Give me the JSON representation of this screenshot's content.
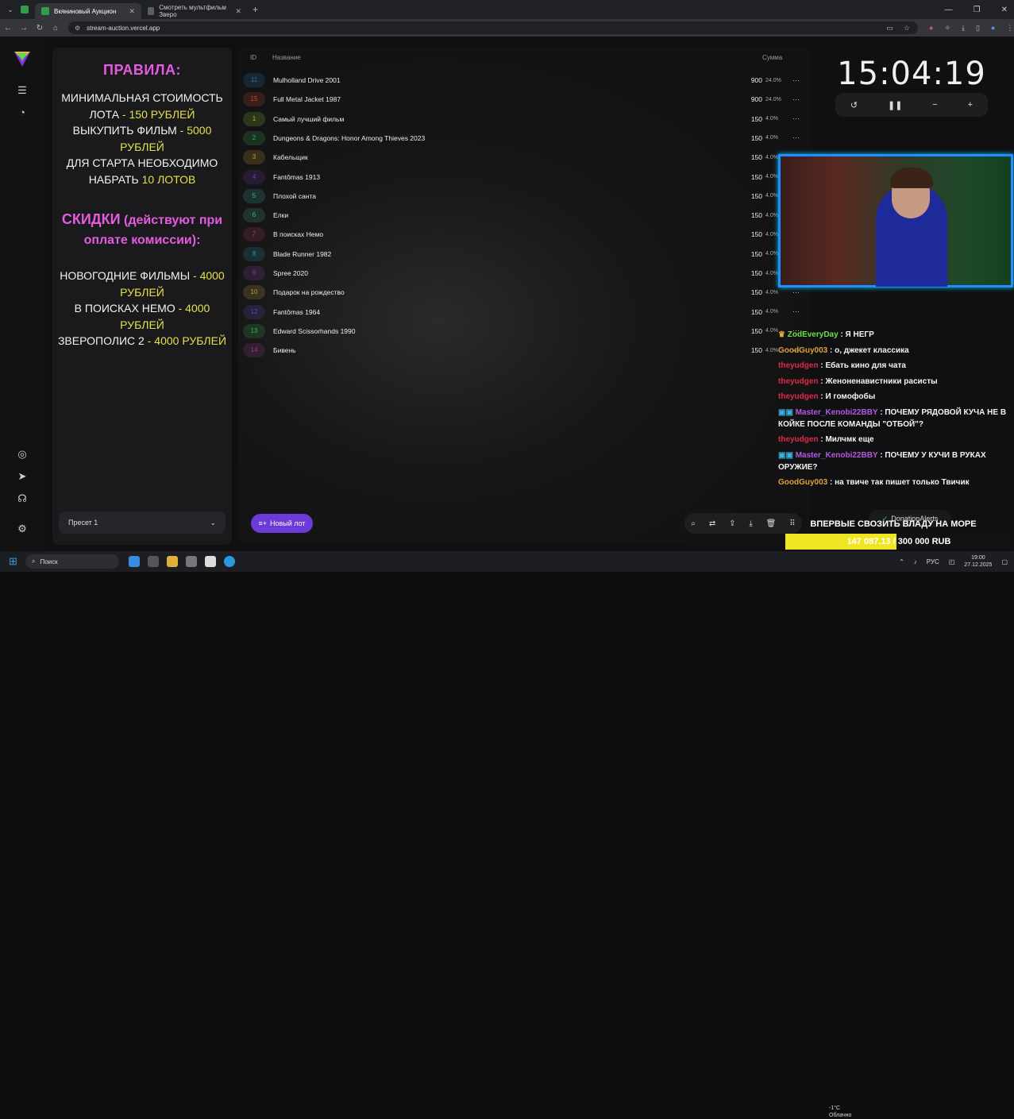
{
  "browser": {
    "tabs": [
      {
        "title": "Вкяниновый Аукцион",
        "favicon_color": "#2e9e4a"
      },
      {
        "title": "Смотреть мультфильм Зверо",
        "favicon_color": "#5a5f66"
      }
    ],
    "new_tab": "+",
    "url": "stream-auction.vercel.app"
  },
  "rules": {
    "title": "ПРАВИЛА:",
    "line1a": "МИНИМАЛЬНАЯ СТОИМОСТЬ ЛОТА",
    "line1b": " - 150 РУБЛЕЙ",
    "line2a": "ВЫКУПИТЬ ФИЛЬМ",
    "line2b": " - 5000 РУБЛЕЙ",
    "line3a": "ДЛЯ СТАРТА НЕОБХОДИМО НАБРАТЬ ",
    "line3b": "10 ЛОТОВ",
    "discount_title": "СКИДКИ",
    "discount_sub": " (действуют при оплате комиссии):",
    "d1a": "НОВОГОДНИЕ ФИЛЬМЫ",
    "d1b": " - 4000 РУБЛЕЙ",
    "d2a": "В ПОИСКАХ НЕМО",
    "d2b": " - 4000 РУБЛЕЙ",
    "d3a": "ЗВЕРОПОЛИС 2",
    "d3b": " - 4000 РУБЛЕЙ"
  },
  "preset": {
    "label": "Пресет 1"
  },
  "table": {
    "col_id": "ID",
    "col_name": "Название",
    "col_sum": "Сумма",
    "rows": [
      {
        "id": "11",
        "name": "Mulholland Drive 2001",
        "sum": "900",
        "pct": "24.0%",
        "color": "#2f6fb0"
      },
      {
        "id": "15",
        "name": "Full Metal Jacket 1987",
        "sum": "900",
        "pct": "24.0%",
        "color": "#c0502a"
      },
      {
        "id": "1",
        "name": "Самый лучший фильм",
        "sum": "150",
        "pct": "4.0%",
        "color": "#8ac43a"
      },
      {
        "id": "2",
        "name": "Dungeons & Dragons: Honor Among Thieves 2023",
        "sum": "150",
        "pct": "4.0%",
        "color": "#3aa860"
      },
      {
        "id": "3",
        "name": "Кабельщик",
        "sum": "150",
        "pct": "4.0%",
        "color": "#c9a23a"
      },
      {
        "id": "4",
        "name": "Fantômas 1913",
        "sum": "150",
        "pct": "4.0%",
        "color": "#7a3ab0"
      },
      {
        "id": "5",
        "name": "Плохой санта",
        "sum": "150",
        "pct": "4.0%",
        "color": "#3ab0a0"
      },
      {
        "id": "6",
        "name": "Елки",
        "sum": "150",
        "pct": "4.0%",
        "color": "#4ab07a"
      },
      {
        "id": "7",
        "name": "В поисках Немо",
        "sum": "150",
        "pct": "4.0%",
        "color": "#b03a5a"
      },
      {
        "id": "8",
        "name": "Blade Runner 1982",
        "sum": "150",
        "pct": "4.0%",
        "color": "#3a8ab0"
      },
      {
        "id": "9",
        "name": "Spree 2020",
        "sum": "150",
        "pct": "4.0%",
        "color": "#8a3ab0"
      },
      {
        "id": "10",
        "name": "Подарок на рождество",
        "sum": "150",
        "pct": "4.0%",
        "color": "#c0a03a"
      },
      {
        "id": "12",
        "name": "Fantômas 1964",
        "sum": "150",
        "pct": "4.0%",
        "color": "#5a4ac0"
      },
      {
        "id": "13",
        "name": "Edward Scissorhands 1990",
        "sum": "150",
        "pct": "4.0%",
        "color": "#3ab050"
      },
      {
        "id": "14",
        "name": "Бивень",
        "sum": "150",
        "pct": "4.0%",
        "color": "#a03a8a"
      }
    ]
  },
  "new_lot": {
    "label": "Новый лот"
  },
  "timer": {
    "time": "15:04:19"
  },
  "chat": [
    {
      "user": "ZodEveryDay",
      "text": " : Я НЕГР",
      "color": "#6ee04a",
      "badge": "crown"
    },
    {
      "user": "GoodGuy003",
      "text": " : о, джекет классика",
      "color": "#e0a040",
      "badge": ""
    },
    {
      "user": "theyudgen",
      "text": " : Ебать кино для чата",
      "color": "#e02a4a",
      "badge": ""
    },
    {
      "user": "theyudgen",
      "text": " : Женоненавистники расисты",
      "color": "#e02a4a",
      "badge": ""
    },
    {
      "user": "theyudgen",
      "text": " : И гомофобы",
      "color": "#e02a4a",
      "badge": ""
    },
    {
      "user": "Master_Kenobi22BBY",
      "text": " : ПОЧЕМУ РЯДОВОЙ КУЧА НЕ В КОЙКЕ ПОСЛЕ КОМАНДЫ \"ОТБОЙ\"?",
      "color": "#b05ae0",
      "badge": "prime"
    },
    {
      "user": "theyudgen",
      "text": " : Милчмк еще",
      "color": "#e02a4a",
      "badge": ""
    },
    {
      "user": "Master_Kenobi22BBY",
      "text": " : ПОЧЕМУ У КУЧИ В РУКАХ ОРУЖИЕ?",
      "color": "#b05ae0",
      "badge": "prime"
    },
    {
      "user": "GoodGuy003",
      "text": " : на твиче так пишет только Твичик",
      "color": "#e0a040",
      "badge": ""
    }
  ],
  "donation": {
    "label": "DonationAlerts"
  },
  "goal": {
    "title": "ВПЕРВЫЕ СВОЗИТЬ ВЛАДУ НА МОРЕ",
    "text": "147 087.13 / 300 000 RUB",
    "progress": 0.49
  },
  "taskbar": {
    "search": "Поиск",
    "weather_temp": "-1°C",
    "weather_desc": "Облачно",
    "lang": "РУС",
    "time": "19:00",
    "date": "27.12.2025"
  }
}
